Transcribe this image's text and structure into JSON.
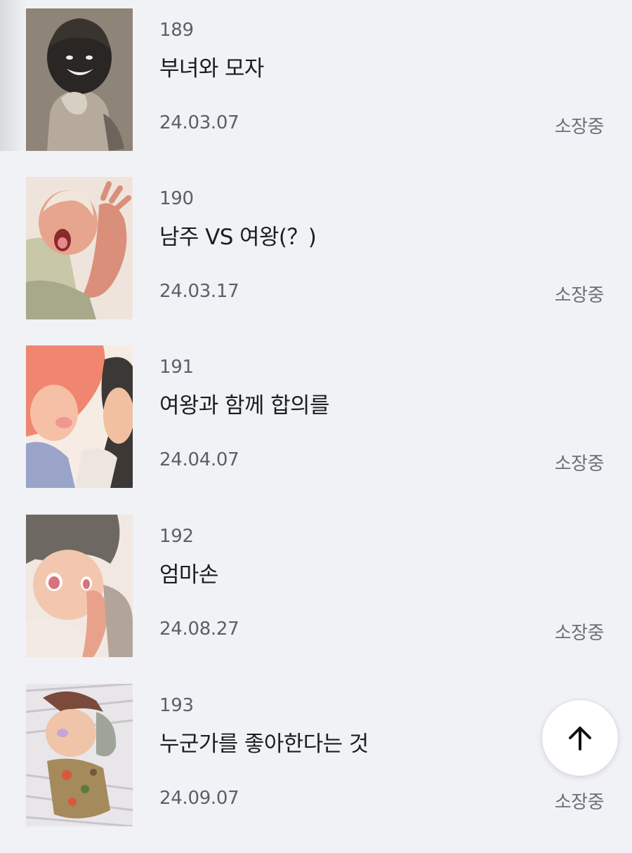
{
  "episodes": [
    {
      "number": "189",
      "title": "부녀와 모자",
      "date": "24.03.07",
      "status": "소장중",
      "thumbnail": "episode-189-thumbnail"
    },
    {
      "number": "190",
      "title": "남주 VS 여왕(？)",
      "date": "24.03.17",
      "status": "소장중",
      "thumbnail": "episode-190-thumbnail"
    },
    {
      "number": "191",
      "title": "여왕과 함께 합의를",
      "date": "24.04.07",
      "status": "소장중",
      "thumbnail": "episode-191-thumbnail"
    },
    {
      "number": "192",
      "title": "엄마손",
      "date": "24.08.27",
      "status": "소장중",
      "thumbnail": "episode-192-thumbnail"
    },
    {
      "number": "193",
      "title": "누군가를 좋아한다는 것",
      "date": "24.09.07",
      "status": "소장중",
      "thumbnail": "episode-193-thumbnail"
    }
  ],
  "scroll_top_button": {
    "icon": "arrow-up-icon"
  },
  "colors": {
    "background": "#f1f2f6",
    "title_text": "#1c1d21",
    "meta_text": "#5c5f66",
    "button_background": "#ffffff"
  }
}
